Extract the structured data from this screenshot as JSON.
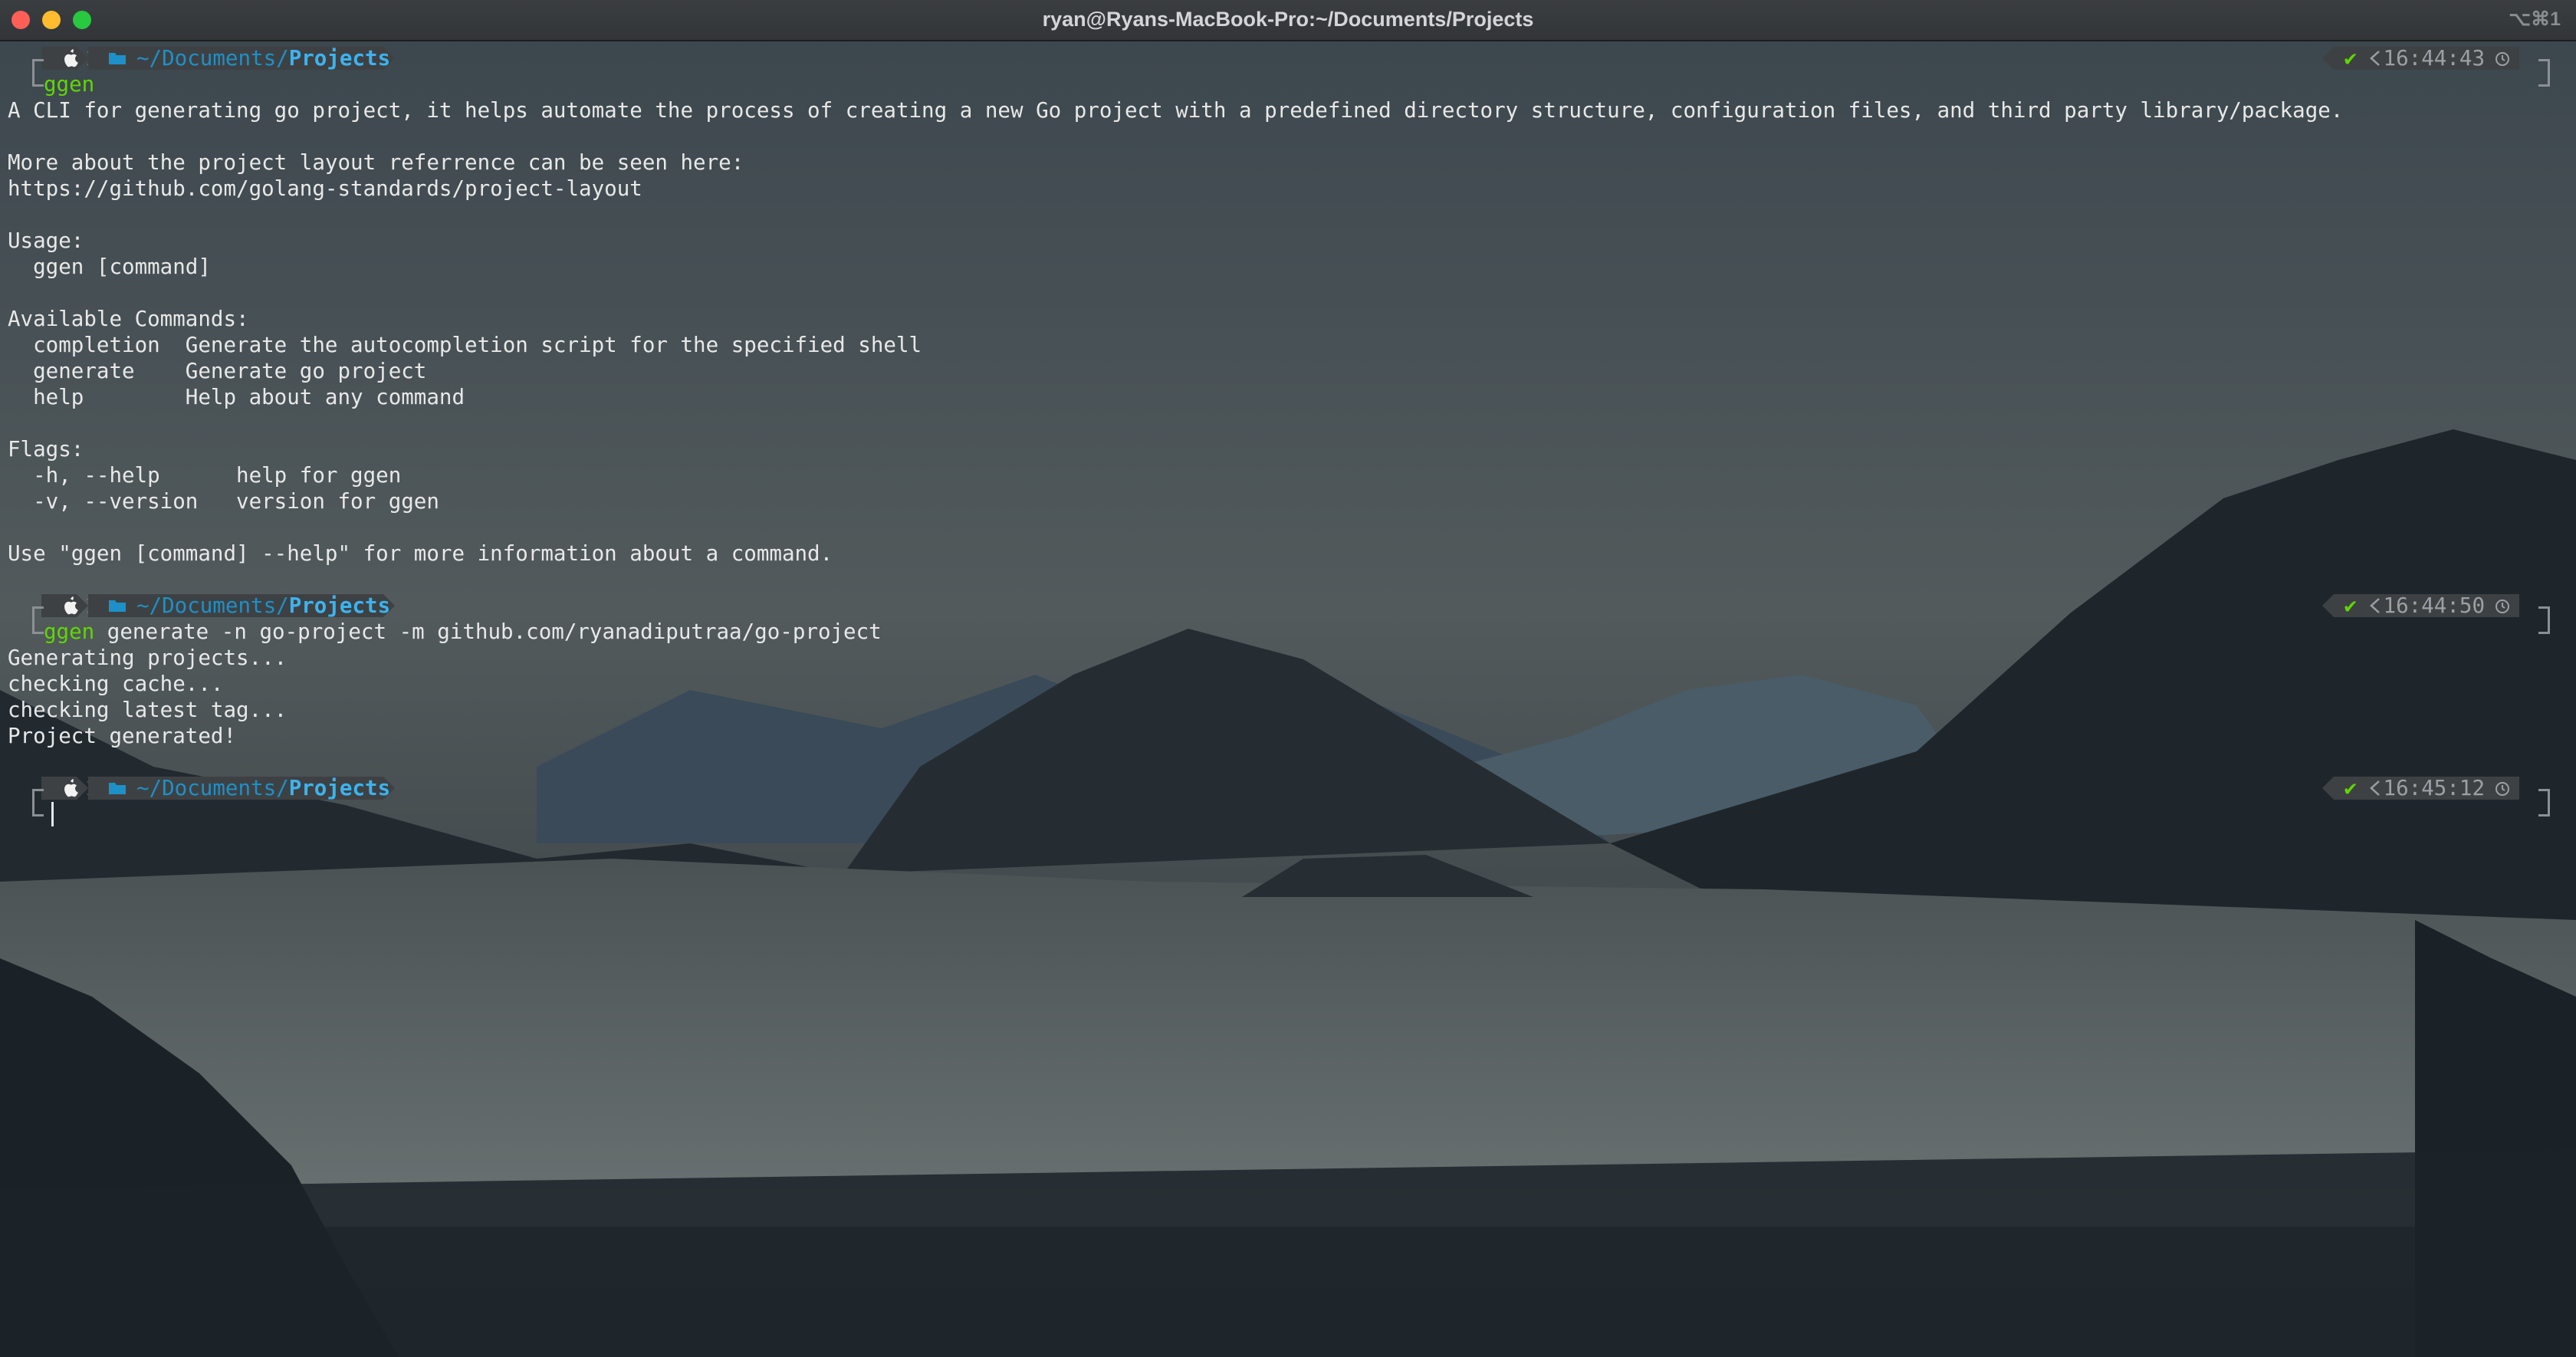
{
  "window": {
    "title": "ryan@Ryans-MacBook-Pro:~/Documents/Projects",
    "shortcut": "⌥⌘1"
  },
  "theme": {
    "accent_green": "#5fd700",
    "path_blue": "#1e90c8",
    "path_bold": "#3cb3f0",
    "segment_bg": "#3e4143",
    "text": "#e8e8e8"
  },
  "prompts": [
    {
      "path_prefix": "~/Documents/",
      "path_dir": "Projects",
      "status": "✔",
      "time": "16:44:43",
      "icons": [
        "apple-icon",
        "folder-icon",
        "clock-icon"
      ]
    },
    {
      "path_prefix": "~/Documents/",
      "path_dir": "Projects",
      "status": "✔",
      "time": "16:44:50"
    },
    {
      "path_prefix": "~/Documents/",
      "path_dir": "Projects",
      "status": "✔",
      "time": "16:45:12"
    }
  ],
  "commands": {
    "cmd1": "ggen",
    "cmd2_name": "ggen",
    "cmd2_args": " generate -n go-project -m github.com/ryanadiputraa/go-project"
  },
  "output1": [
    "A CLI for generating go project, it helps automate the process of creating a new Go project with a predefined directory structure, configuration files, and third party library/package.",
    "",
    "More about the project layout referrence can be seen here:",
    "https://github.com/golang-standards/project-layout",
    "",
    "Usage:",
    "  ggen [command]",
    "",
    "Available Commands:",
    "  completion  Generate the autocompletion script for the specified shell",
    "  generate    Generate go project",
    "  help        Help about any command",
    "",
    "Flags:",
    "  -h, --help      help for ggen",
    "  -v, --version   version for ggen",
    "",
    "Use \"ggen [command] --help\" for more information about a command."
  ],
  "output2": [
    "Generating projects...",
    "checking cache...",
    "checking latest tag...",
    "Project generated!"
  ]
}
